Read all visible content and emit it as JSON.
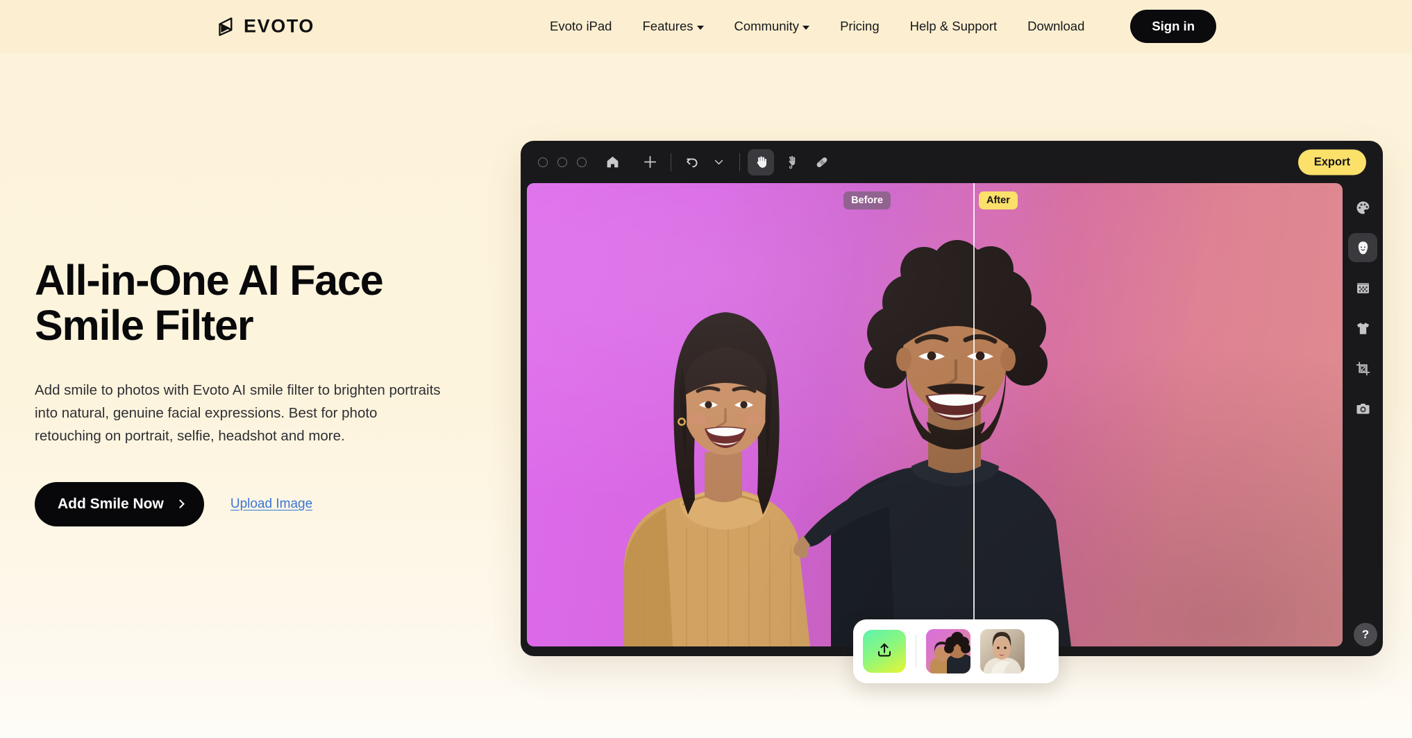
{
  "theme": {
    "page_bg": "#FDF3DA",
    "header_bg": "#FCEFD1",
    "ink": "#09090b",
    "accent_yellow": "#FBE06A",
    "link_blue": "#3A75D6",
    "app_chrome": "#19191B"
  },
  "header": {
    "brand": {
      "name": "EVOTO",
      "logo_icon": "evoto-diamond-logo"
    },
    "nav": [
      {
        "label": "Evoto iPad",
        "has_dropdown": false
      },
      {
        "label": "Features",
        "has_dropdown": true
      },
      {
        "label": "Community",
        "has_dropdown": true
      },
      {
        "label": "Pricing",
        "has_dropdown": false
      },
      {
        "label": "Help & Support",
        "has_dropdown": false
      },
      {
        "label": "Download",
        "has_dropdown": false
      }
    ],
    "sign_in_label": "Sign in"
  },
  "hero": {
    "title_line1": "All-in-One AI Face",
    "title_line2": "Smile Filter",
    "description": "Add smile to photos with Evoto AI smile filter to brighten portraits into natural, genuine facial expressions. Best for photo retouching on portrait, selfie, headshot and more.",
    "primary_cta": "Add Smile Now",
    "secondary_cta": "Upload Image"
  },
  "app_mockup": {
    "window_controls": [
      "window-dot-1",
      "window-dot-2",
      "window-dot-3"
    ],
    "toolbar_tools": [
      {
        "name": "home-icon",
        "icon": "home",
        "active": false
      },
      {
        "name": "add-icon",
        "icon": "plus",
        "active": false
      },
      {
        "name": "undo-icon",
        "icon": "undo",
        "active": false
      },
      {
        "name": "chevron-down-icon",
        "icon": "chevron-down",
        "active": false
      },
      {
        "name": "hand-tool-icon",
        "icon": "hand",
        "active": true
      },
      {
        "name": "smudge-tool-icon",
        "icon": "smudge",
        "active": false
      },
      {
        "name": "healing-tool-icon",
        "icon": "bandage",
        "active": false
      }
    ],
    "export_label": "Export",
    "compare": {
      "before_label": "Before",
      "after_label": "After",
      "divider_position_pct": 55
    },
    "side_rail": [
      {
        "name": "color-palette-icon",
        "icon": "palette",
        "active": false
      },
      {
        "name": "face-retouch-icon",
        "icon": "face",
        "active": true
      },
      {
        "name": "texture-icon",
        "icon": "texture",
        "active": false
      },
      {
        "name": "clothing-icon",
        "icon": "shirt",
        "active": false
      },
      {
        "name": "crop-icon",
        "icon": "crop",
        "active": false
      },
      {
        "name": "camera-icon",
        "icon": "camera",
        "active": false
      }
    ],
    "help_label": "?"
  },
  "thumb_panel": {
    "upload_icon": "upload-arrow-icon",
    "thumbnails": [
      {
        "name": "thumbnail-couple-portrait"
      },
      {
        "name": "thumbnail-bride-portrait"
      }
    ]
  }
}
